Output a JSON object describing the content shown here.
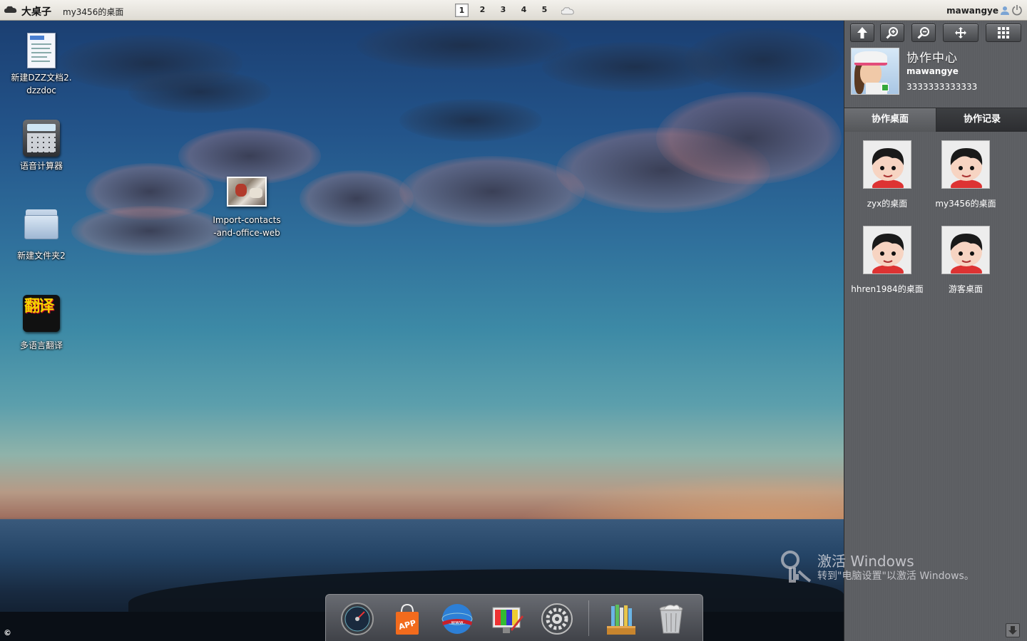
{
  "topbar": {
    "brand": "大桌子",
    "desk_name": "my3456的桌面",
    "pages": [
      "1",
      "2",
      "3",
      "4",
      "5"
    ],
    "active_page": "1",
    "username": "mawangye"
  },
  "desktop": {
    "icons": [
      {
        "label": "新建DZZ文档2.\ndzzdoc",
        "icon": "dzzdoc-file-icon"
      },
      {
        "label": "语音计算器",
        "icon": "calculator-icon"
      },
      {
        "label": "新建文件夹2",
        "icon": "folder-icon"
      },
      {
        "label": "多语言翻译",
        "icon": "translate-app-icon"
      },
      {
        "label": "Import-contacts\n-and-office-web",
        "icon": "image-file-icon"
      }
    ],
    "translate_icon_text": "翻译"
  },
  "panel": {
    "tools": [
      "arrow-up-icon",
      "zoom-in-icon",
      "zoom-out-icon",
      "move-icon",
      "grid-icon"
    ],
    "profile": {
      "title": "协作中心",
      "username": "mawangye",
      "phone": "3333333333333"
    },
    "tabs": [
      {
        "label": "协作桌面",
        "active": true
      },
      {
        "label": "协作记录",
        "active": false
      }
    ],
    "desks": [
      {
        "label": "zyx的桌面"
      },
      {
        "label": "my3456的桌面"
      },
      {
        "label": "hhren1984的桌面"
      },
      {
        "label": "游客桌面"
      }
    ]
  },
  "dock": {
    "items": [
      "dashboard-icon",
      "app-store-icon",
      "browser-icon",
      "paint-icon",
      "settings-icon",
      "library-icon",
      "trash-icon"
    ]
  },
  "watermark": {
    "title": "激活 Windows",
    "subtitle": "转到\"电脑设置\"以激活 Windows。"
  },
  "footer": {
    "copyright": "©"
  }
}
